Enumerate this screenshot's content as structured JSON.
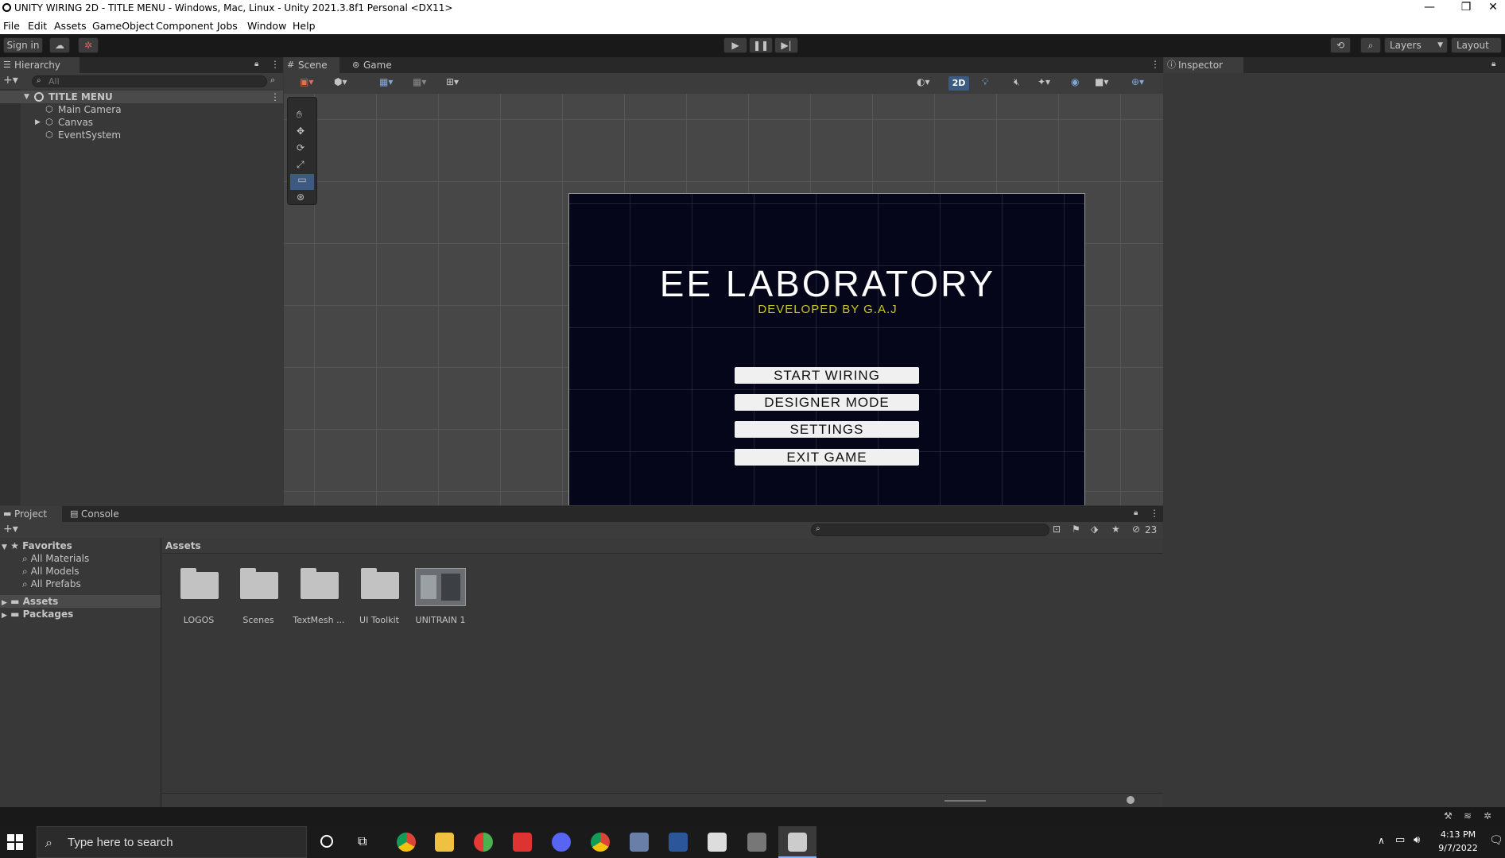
{
  "window": {
    "title": "UNITY WIRING 2D - TITLE MENU - Windows, Mac, Linux - Unity 2021.3.8f1 Personal <DX11>"
  },
  "menu": [
    "File",
    "Edit",
    "Assets",
    "GameObject",
    "Component",
    "Jobs",
    "Window",
    "Help"
  ],
  "toolbar": {
    "sign_in": "Sign in",
    "layers": "Layers",
    "layout": "Layout"
  },
  "hierarchy": {
    "tab": "Hierarchy",
    "search_placeholder": "All",
    "scene_name": "TITLE MENU",
    "items": [
      "Main Camera",
      "Canvas",
      "EventSystem"
    ]
  },
  "scene": {
    "tabs": [
      "Scene",
      "Game"
    ],
    "mode_2d": "2D"
  },
  "game_view": {
    "title": "EE LABORATORY",
    "subtitle": "DEVELOPED BY G.A.J",
    "buttons": [
      "START WIRING",
      "DESIGNER MODE",
      "SETTINGS",
      "EXIT GAME"
    ]
  },
  "inspector": {
    "tab": "Inspector"
  },
  "project": {
    "tabs": [
      "Project",
      "Console"
    ],
    "favorites_label": "Favorites",
    "favorites": [
      "All Materials",
      "All Models",
      "All Prefabs"
    ],
    "tree": [
      "Assets",
      "Packages"
    ],
    "breadcrumb": "Assets",
    "hidden_count": "23",
    "assets": [
      "LOGOS",
      "Scenes",
      "TextMesh ...",
      "UI Toolkit",
      "UNITRAIN 1"
    ]
  },
  "taskbar": {
    "search_placeholder": "Type here to search",
    "time": "4:13 PM",
    "date": "9/7/2022"
  },
  "colors": {
    "accent": "#3d5a80",
    "subtitle": "#c8c820"
  }
}
